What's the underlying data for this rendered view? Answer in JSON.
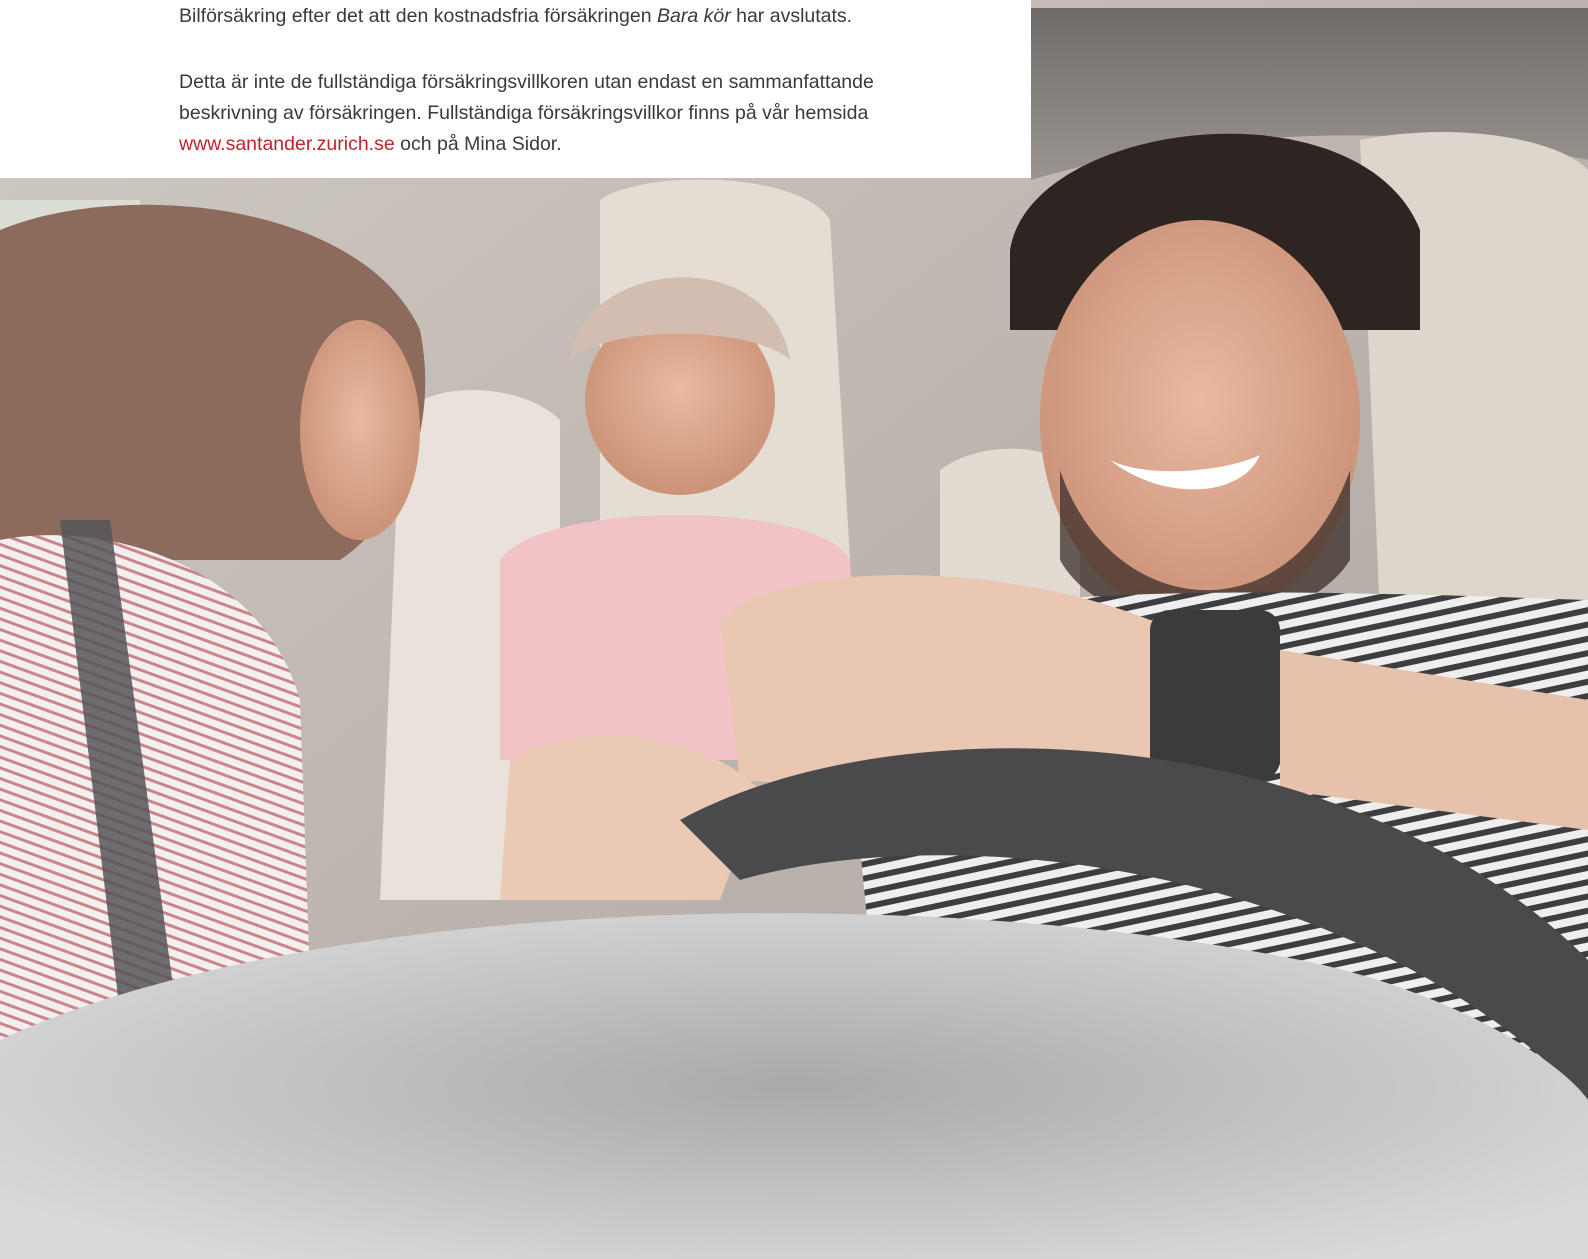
{
  "intro": {
    "line_before_italic": "Bilförsäkring efter det att den kostnadsfria försäkringen ",
    "italic_product": "Bara kör",
    "line_after_italic": " har avslutats."
  },
  "disclaimer": {
    "text_line1": "Detta är inte de fullständiga försäkringsvillkoren utan endast en sammanfattande beskrivning av försäkringen. Fullständiga försäkringsvillkor finns på vår hemsida ",
    "link_text": "www.santander.zurich.se",
    "text_after_link": " och på Mina Sidor."
  },
  "colors": {
    "link": "#c0232b",
    "body_text": "#3a3a3a"
  }
}
